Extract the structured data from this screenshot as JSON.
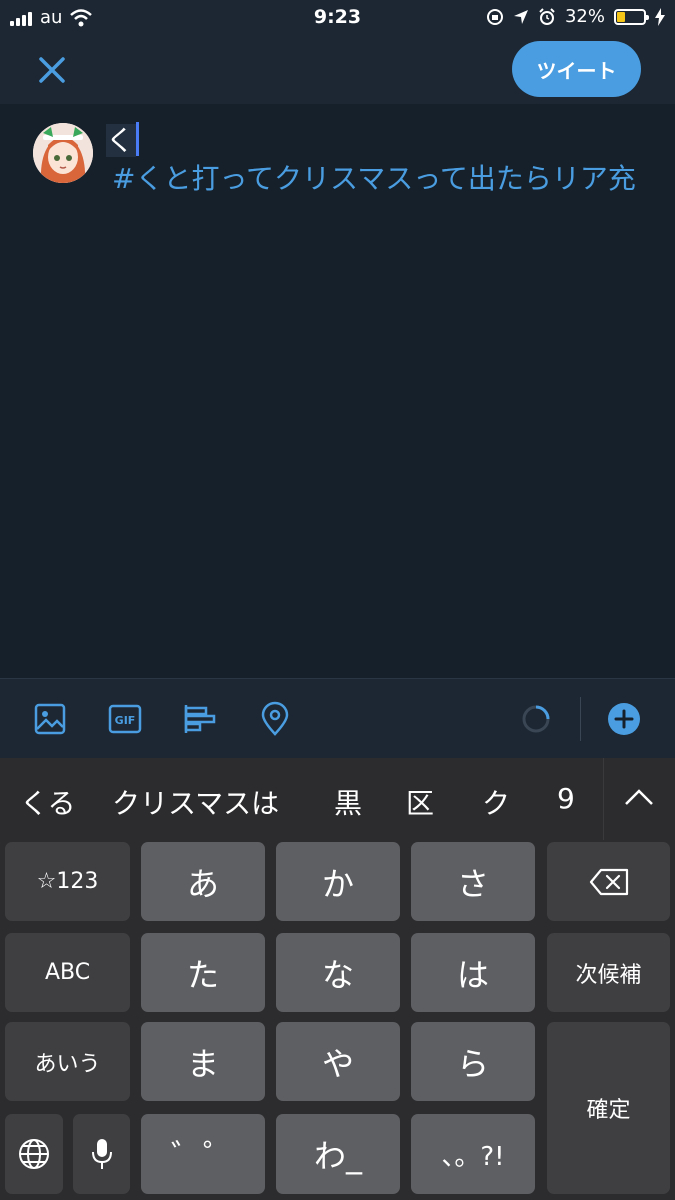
{
  "status_bar": {
    "carrier": "au",
    "time": "9:23",
    "battery_pct": "32%",
    "battery_level": 0.32
  },
  "header": {
    "tweet_label": "ツイート"
  },
  "compose": {
    "typed_text": "く",
    "suggestion_text": "#くと打ってクリスマスって出たらリア充"
  },
  "keyboard": {
    "candidates": [
      "くる",
      "クリスマスは",
      "黒",
      "区",
      "ク",
      "9"
    ],
    "keys": {
      "num": "☆123",
      "a": "あ",
      "ka": "か",
      "sa": "さ",
      "abc": "ABC",
      "ta": "た",
      "na": "な",
      "ha": "は",
      "next_cand": "次候補",
      "kana": "あいう",
      "ma": "ま",
      "ya": "や",
      "ra": "ら",
      "confirm": "確定",
      "dakuten": "゛゜",
      "wa": "わ_",
      "punct": "、。?!"
    }
  },
  "colors": {
    "accent": "#4a9de0",
    "background": "#15202b",
    "bar": "#1c2733"
  }
}
